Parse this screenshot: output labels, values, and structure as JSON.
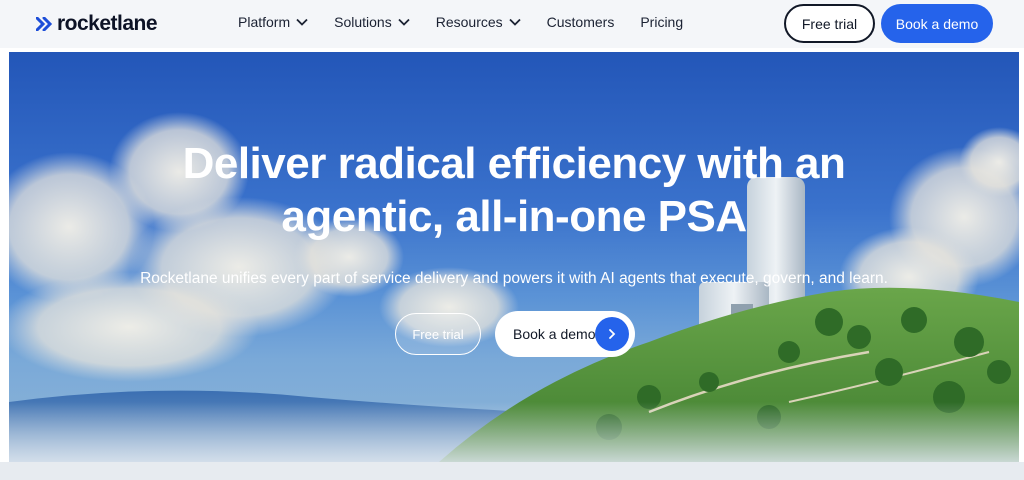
{
  "brand": {
    "name": "rocketlane"
  },
  "nav": {
    "items": [
      {
        "label": "Platform",
        "dropdown": true
      },
      {
        "label": "Solutions",
        "dropdown": true
      },
      {
        "label": "Resources",
        "dropdown": true
      },
      {
        "label": "Customers",
        "dropdown": false
      },
      {
        "label": "Pricing",
        "dropdown": false
      }
    ],
    "free_trial": "Free trial",
    "book_demo": "Book a demo"
  },
  "hero": {
    "title_line1": "Deliver radical efficiency with an",
    "title_line2": "agentic, all-in-one PSA",
    "subtitle": "Rocketlane unifies every part of service delivery and powers it with AI agents that execute, govern, and learn.",
    "free_trial": "Free trial",
    "book_demo": "Book a demo"
  },
  "colors": {
    "primary": "#2563eb",
    "dark": "#111827",
    "header_bg": "#f4f6f9"
  },
  "icons": {
    "logo": "double-chevron-logo-icon",
    "dropdown": "chevron-down-icon",
    "cta_arrow": "arrow-right-icon"
  }
}
